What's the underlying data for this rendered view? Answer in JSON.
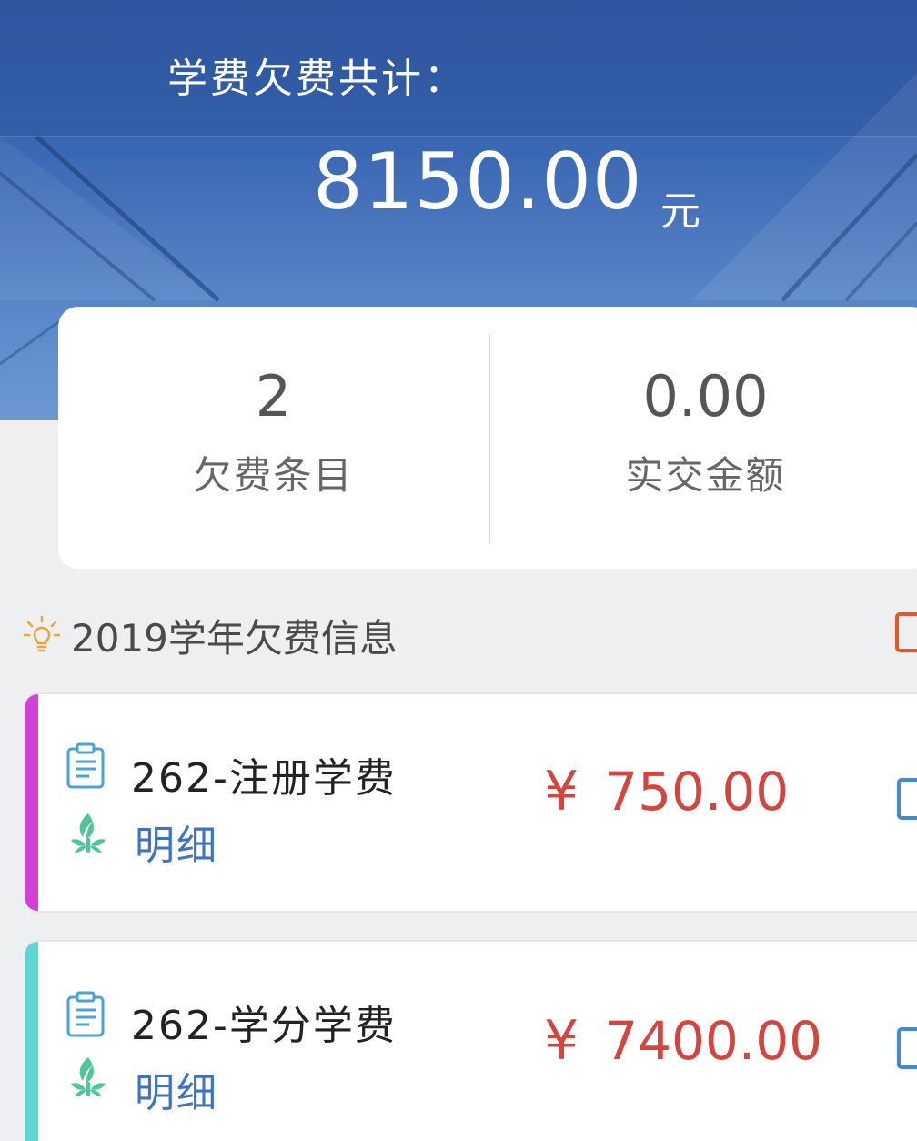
{
  "colors": {
    "hero_top": "#2f59a3",
    "hero_bottom": "#6d98d2",
    "price_red": "#d2463f",
    "link_blue": "#3f72c4",
    "stripe_magenta": "#d53fd6",
    "stripe_cyan": "#5fd6d4",
    "checkbox_orange": "#e2572b",
    "checkbox_blue": "#3f8bd8"
  },
  "header": {
    "label": "学费欠费共计：",
    "amount": "8150.00",
    "unit": "元"
  },
  "summary": {
    "items_count": "2",
    "items_label": "欠费条目",
    "paid_amount": "0.00",
    "paid_label": "实交金额"
  },
  "section": {
    "icon": "lightbulb-icon",
    "title": "2019学年欠费信息"
  },
  "fees": [
    {
      "name": "262-注册学费",
      "detail_label": "明细",
      "currency": "¥",
      "amount": "750.00",
      "icon": "clipboard-icon",
      "detail_icon": "leaf-icon"
    },
    {
      "name": "262-学分学费",
      "detail_label": "明细",
      "currency": "¥",
      "amount": "7400.00",
      "icon": "clipboard-icon",
      "detail_icon": "leaf-icon"
    }
  ]
}
